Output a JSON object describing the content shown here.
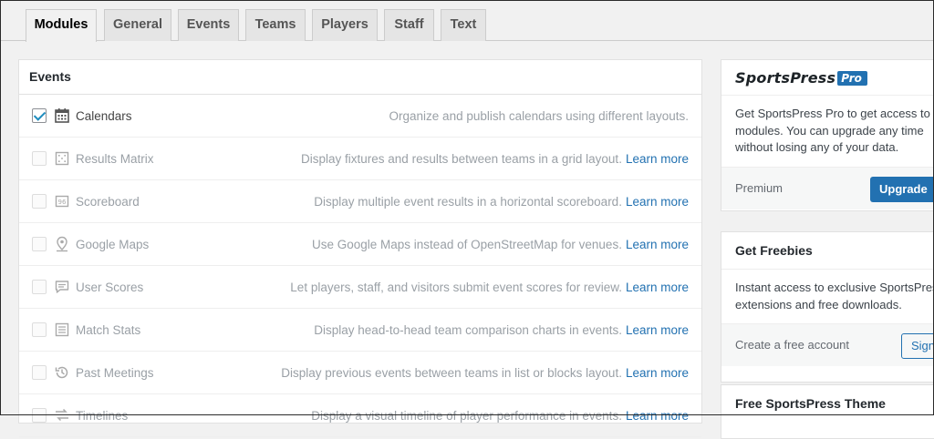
{
  "tabs": [
    {
      "label": "Modules",
      "active": true
    },
    {
      "label": "General"
    },
    {
      "label": "Events"
    },
    {
      "label": "Teams"
    },
    {
      "label": "Players"
    },
    {
      "label": "Staff"
    },
    {
      "label": "Text"
    }
  ],
  "events_panel": {
    "title": "Events",
    "learn_more": "Learn more",
    "modules": [
      {
        "name": "Calendars",
        "icon": "calendar-icon",
        "checked": true,
        "description": "Organize and publish calendars using different layouts.",
        "has_learn_more": false
      },
      {
        "name": "Results Matrix",
        "icon": "grid-icon",
        "checked": false,
        "description": "Display fixtures and results between teams in a grid layout.",
        "has_learn_more": true
      },
      {
        "name": "Scoreboard",
        "icon": "scoreboard-icon",
        "checked": false,
        "description": "Display multiple event results in a horizontal scoreboard.",
        "has_learn_more": true
      },
      {
        "name": "Google Maps",
        "icon": "map-pin-icon",
        "checked": false,
        "description": "Use Google Maps instead of OpenStreetMap for venues.",
        "has_learn_more": true
      },
      {
        "name": "User Scores",
        "icon": "speech-bubble-icon",
        "checked": false,
        "description": "Let players, staff, and visitors submit event scores for review.",
        "has_learn_more": true
      },
      {
        "name": "Match Stats",
        "icon": "stats-chart-icon",
        "checked": false,
        "description": "Display head-to-head team comparison charts in events.",
        "has_learn_more": true
      },
      {
        "name": "Past Meetings",
        "icon": "history-icon",
        "checked": false,
        "description": "Display previous events between teams in list or blocks layout.",
        "has_learn_more": true
      },
      {
        "name": "Timelines",
        "icon": "timeline-icon",
        "checked": false,
        "description": "Display a visual timeline of player performance in events.",
        "has_learn_more": true
      }
    ]
  },
  "pro_box": {
    "brand": "SportsPress",
    "brand_badge": "Pro",
    "body_lines": [
      "Get SportsPress Pro to get access to",
      "modules. You can upgrade any time",
      "without losing any of your data."
    ],
    "footer_label": "Premium",
    "button": "Upgrade"
  },
  "freebies_box": {
    "title": "Get Freebies",
    "body_lines": [
      "Instant access to exclusive SportsPress",
      "extensions and free downloads."
    ],
    "footer_label": "Create a free account",
    "button": "Sign Up"
  },
  "theme_box": {
    "title": "Free SportsPress Theme"
  },
  "colors": {
    "accent": "#2271b1",
    "checkbox_check": "#1e8cbe"
  }
}
